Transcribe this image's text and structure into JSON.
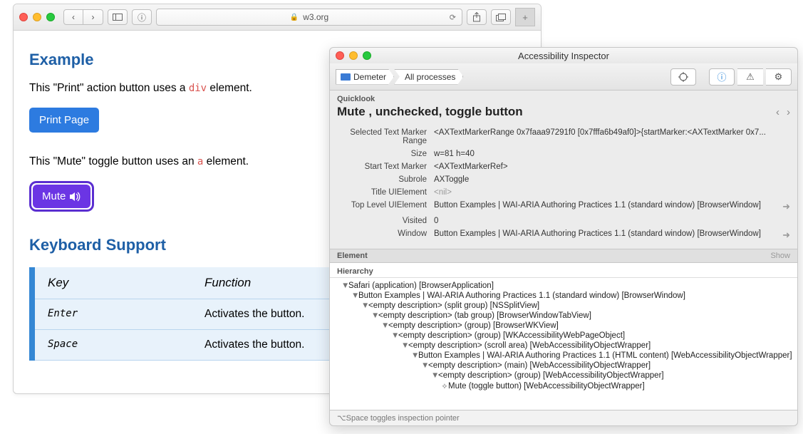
{
  "safari": {
    "url_host": "w3.org"
  },
  "page": {
    "heading_example": "Example",
    "print_intro_pre": "This \"Print\" action button uses a ",
    "print_tag": "div",
    "print_intro_post": " element.",
    "print_button": "Print Page",
    "mute_intro_pre": "This \"Mute\" toggle button uses an ",
    "mute_tag": "a",
    "mute_intro_post": " element.",
    "mute_button": "Mute",
    "heading_kb": "Keyboard Support",
    "kb_table": {
      "headers": {
        "key": "Key",
        "function": "Function"
      },
      "rows": [
        {
          "key": "Enter",
          "function": "Activates the button."
        },
        {
          "key": "Space",
          "function": "Activates the button."
        }
      ]
    }
  },
  "inspector": {
    "title": "Accessibility Inspector",
    "breadcrumb": {
      "host": "Demeter",
      "target": "All processes"
    },
    "quicklook_label": "Quicklook",
    "quicklook_title": "Mute ,  unchecked, toggle button",
    "properties": [
      {
        "key": "Selected Text Marker Range",
        "value": "<AXTextMarkerRange 0x7faaa97291f0 [0x7fffa6b49af0]>{startMarker:<AXTextMarker 0x7..."
      },
      {
        "key": "Size",
        "value": "w=81 h=40"
      },
      {
        "key": "Start Text Marker",
        "value": "<AXTextMarkerRef>"
      },
      {
        "key": "Subrole",
        "value": "AXToggle"
      },
      {
        "key": "Title UIElement",
        "value": "<nil>",
        "nil": true
      },
      {
        "key": "Top Level UIElement",
        "value": "Button Examples | WAI-ARIA Authoring Practices 1.1 (standard window) [BrowserWindow]",
        "goto": true
      },
      {
        "key": "Visited",
        "value": "0"
      },
      {
        "key": "Window",
        "value": "Button Examples | WAI-ARIA Authoring Practices 1.1 (standard window) [BrowserWindow]",
        "goto": true
      }
    ],
    "element_label": "Element",
    "show_label": "Show",
    "hierarchy_label": "Hierarchy",
    "hierarchy": [
      {
        "indent": 0,
        "disclosure": "▼",
        "text": "Safari (application) [BrowserApplication]"
      },
      {
        "indent": 1,
        "disclosure": "▼",
        "text": "Button Examples | WAI-ARIA Authoring Practices 1.1 (standard window) [BrowserWindow]"
      },
      {
        "indent": 2,
        "disclosure": "▼",
        "text": "<empty description> (split group) [NSSplitView]"
      },
      {
        "indent": 3,
        "disclosure": "▼",
        "text": "<empty description> (tab group) [BrowserWindowTabView]"
      },
      {
        "indent": 4,
        "disclosure": "▼",
        "text": "<empty description> (group) [BrowserWKView]"
      },
      {
        "indent": 5,
        "disclosure": "▼",
        "text": "<empty description> (group) [WKAccessibilityWebPageObject]"
      },
      {
        "indent": 6,
        "disclosure": "▼",
        "text": "<empty description> (scroll area) [WebAccessibilityObjectWrapper]"
      },
      {
        "indent": 7,
        "disclosure": "▼",
        "text": "Button Examples | WAI-ARIA Authoring Practices 1.1 (HTML content) [WebAccessibilityObjectWrapper]"
      },
      {
        "indent": 8,
        "disclosure": "▼",
        "text": "<empty description> (main) [WebAccessibilityObjectWrapper]"
      },
      {
        "indent": 9,
        "disclosure": "▼",
        "text": "<empty description> (group) [WebAccessibilityObjectWrapper]"
      },
      {
        "indent": 10,
        "disclosure": "✧",
        "text": "Mute (toggle button) [WebAccessibilityObjectWrapper]"
      }
    ],
    "footer": "⌥Space toggles inspection pointer"
  }
}
